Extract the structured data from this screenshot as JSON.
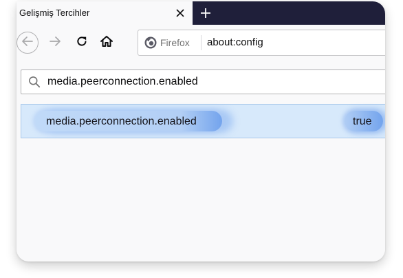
{
  "tab": {
    "title": "Gelişmiş Tercihler"
  },
  "icons": {
    "tab_close": "close-icon",
    "new_tab": "plus-icon",
    "back": "arrow-left-icon",
    "forward": "arrow-right-icon",
    "reload": "reload-icon",
    "home": "home-icon",
    "identity": "firefox-icon",
    "search": "search-icon"
  },
  "urlbar": {
    "identity_label": "Firefox",
    "url": "about:config"
  },
  "search": {
    "value": "media.peerconnection.enabled"
  },
  "preferences": [
    {
      "name": "media.peerconnection.enabled",
      "value": "true"
    }
  ],
  "colors": {
    "tabstrip": "#1f1f3a",
    "selected_row": "#d7e9fb",
    "highlight": "#6ea0ec"
  }
}
